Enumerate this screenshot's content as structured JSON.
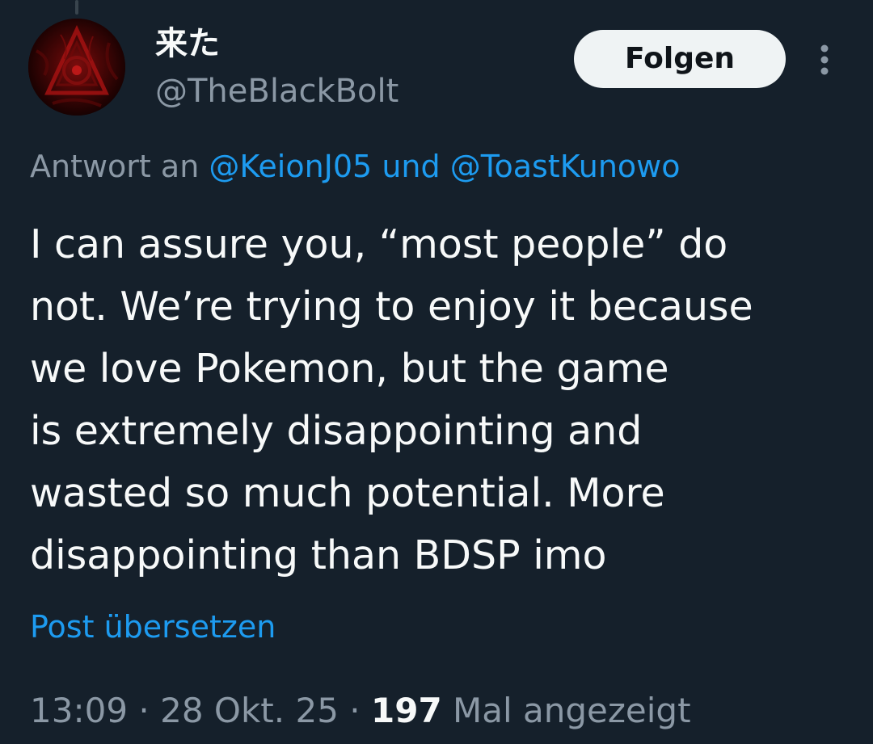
{
  "author": {
    "display_name": "来た",
    "handle": "@TheBlackBolt",
    "avatar_icon": "dark-red-abstract-avatar"
  },
  "follow_button": {
    "label": "Folgen"
  },
  "more_menu": {
    "icon": "more-vertical-icon"
  },
  "reply_context": {
    "prefix": "Antwort an",
    "user1": "@KeionJ05",
    "conjunction": "und",
    "user2": "@ToastKunowo"
  },
  "tweet": {
    "lines": [
      "I can assure you, “most people” do",
      "not. We’re trying to enjoy it because",
      "we love Pokemon, but the game",
      "is extremely disappointing and",
      "wasted so much potential. More",
      "disappointing than BDSP imo"
    ]
  },
  "translate_link": "Post übersetzen",
  "meta": {
    "time": "13:09",
    "separator": "·",
    "date": "28 Okt. 25",
    "views_count": "197",
    "views_label": "Mal angezeigt"
  },
  "colors": {
    "background": "#15202b",
    "primary_text": "#f7f9f9",
    "secondary_text": "#8b98a5",
    "accent": "#1d9bf0",
    "button_bg": "#eff3f4"
  }
}
